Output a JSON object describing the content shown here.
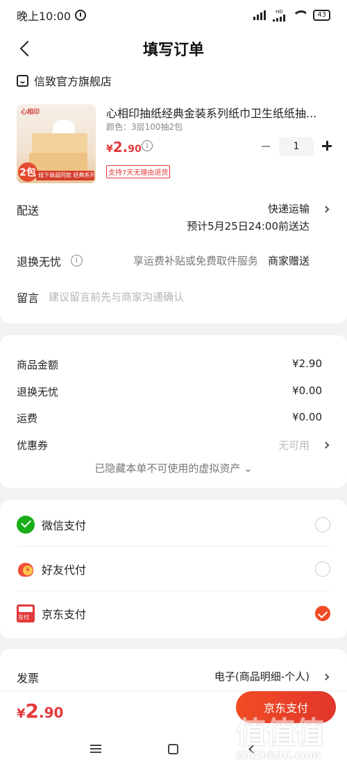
{
  "status_bar": {
    "time": "晚上10:00",
    "network_label": "HD",
    "battery": "43"
  },
  "header": {
    "title": "填写订单"
  },
  "store": {
    "name": "信致官方旗舰店"
  },
  "product": {
    "name": "心相印抽纸经典金装系列纸巾卫生纸纸抽...",
    "spec": "颜色：3层100抽2包",
    "price_currency": "¥",
    "price_int": "2.",
    "price_dec": "90",
    "quantity": "1",
    "return_tag": "支持7天无理由退货",
    "image_badge": "2包",
    "image_ribbon": "线下商超同款 经典系列",
    "image_logo": "心相印"
  },
  "delivery": {
    "label": "配送",
    "method": "快递运输",
    "eta": "预计5月25日24:00前送达"
  },
  "returns": {
    "label": "退换无忧",
    "desc": "享运费补贴或免费取件服务",
    "gift": "商家赠送"
  },
  "message": {
    "label": "留言",
    "placeholder": "建议留言前先与商家沟通确认"
  },
  "summary": {
    "goods_label": "商品金额",
    "goods_value": "¥2.90",
    "returns_label": "退换无忧",
    "returns_value": "¥0.00",
    "shipping_label": "运费",
    "shipping_value": "¥0.00",
    "coupon_label": "优惠券",
    "coupon_value": "无可用",
    "hidden_note": "已隐藏本单不可使用的虚拟资产 ⌄"
  },
  "payment": {
    "methods": [
      {
        "name": "微信支付",
        "icon": "wechat-pay-icon",
        "selected": false
      },
      {
        "name": "好友代付",
        "icon": "friend-pay-icon",
        "selected": false
      },
      {
        "name": "京东支付",
        "icon": "jd-pay-icon",
        "selected": true
      }
    ]
  },
  "invoice": {
    "label": "发票",
    "value": "电子(商品明细-个人)"
  },
  "bottom": {
    "total_currency": "¥",
    "total_int": "2",
    "total_dec": ".90",
    "pay_button": "京东支付"
  },
  "watermark": {
    "glyphs": "值值值",
    "site": "zhizhizhi.com"
  },
  "colors": {
    "accent": "#e4393c",
    "pay_button": "#f04b24",
    "wechat": "#1aad19"
  }
}
